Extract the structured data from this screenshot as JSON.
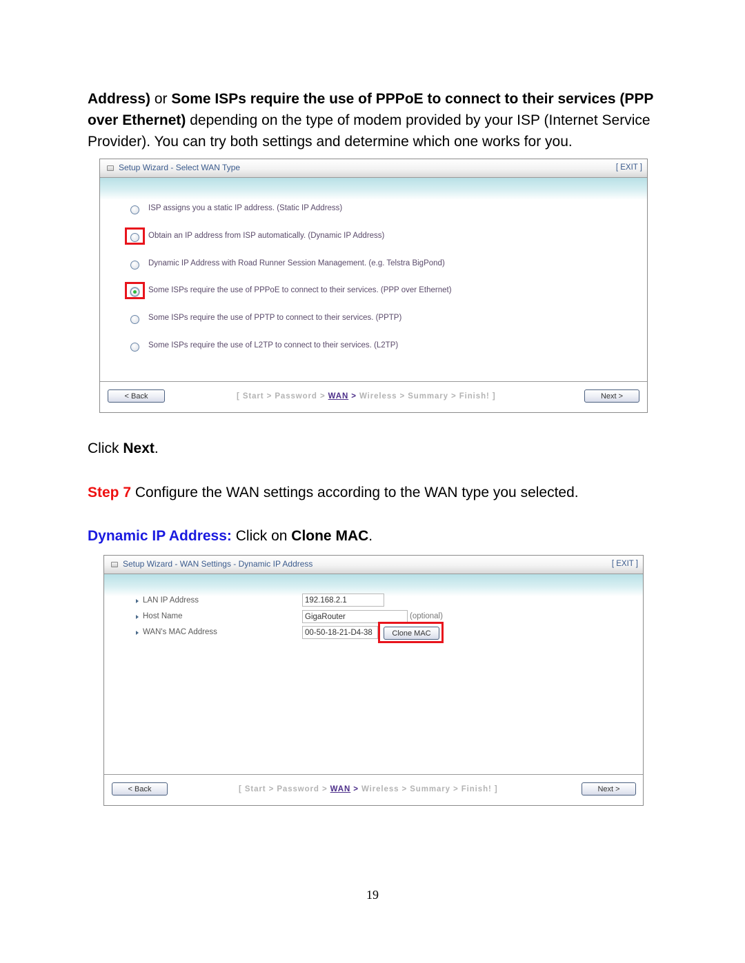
{
  "intro": {
    "line1_bold_a": "Address)",
    "line1_or": " or ",
    "line1_bold_b": "Some ISPs require the use of PPPoE to connect to their services (PPP",
    "line2_bold": "over Ethernet)",
    "line2_rest": " depending on the type of modem provided by your ISP (Internet Service",
    "line3": "Provider). You can try both settings and determine which one works for you."
  },
  "wizard1": {
    "title": "Setup Wizard - Select WAN Type",
    "exit_label": "[ EXIT ]",
    "options": [
      {
        "label": "ISP assigns you a static IP address. (Static IP Address)",
        "checked": false,
        "highlighted": false
      },
      {
        "label": "Obtain an IP address from ISP automatically. (Dynamic IP Address)",
        "checked": false,
        "highlighted": true
      },
      {
        "label": "Dynamic IP Address with Road Runner Session Management. (e.g. Telstra BigPond)",
        "checked": false,
        "highlighted": false
      },
      {
        "label": "Some ISPs require the use of PPPoE to connect to their services. (PPP over Ethernet)",
        "checked": true,
        "highlighted": true
      },
      {
        "label": "Some ISPs require the use of PPTP to connect to their services. (PPTP)",
        "checked": false,
        "highlighted": false
      },
      {
        "label": "Some ISPs require the use of L2TP to connect to their services. (L2TP)",
        "checked": false,
        "highlighted": false
      }
    ],
    "back_label": "< Back",
    "next_label": "Next >"
  },
  "breadcrumb": {
    "open": "[ Start > Password > ",
    "current": "WAN",
    "current_sep": " > ",
    "rest": "Wireless > Summary > Finish! ]"
  },
  "click_next": {
    "prefix": "Click ",
    "bold": "Next",
    "suffix": "."
  },
  "step7": {
    "label": "Step 7",
    "text": " Configure the WAN settings according to the WAN type you selected."
  },
  "dynamic_ip": {
    "label": "Dynamic IP Address:",
    "text_a": " Click on ",
    "bold": "Clone MAC",
    "suffix": "."
  },
  "wizard2": {
    "title": "Setup Wizard - WAN Settings - Dynamic IP Address",
    "exit_label": "[ EXIT ]",
    "fields": [
      {
        "label": "LAN IP Address",
        "value": "192.168.2.1"
      },
      {
        "label": "Host Name",
        "value": "GigaRouter",
        "note": "(optional)"
      },
      {
        "label": "WAN's MAC Address",
        "value": "00-50-18-21-D4-38"
      }
    ],
    "clone_mac_label": "Clone MAC",
    "back_label": "< Back",
    "next_label": "Next >"
  },
  "page_number": "19",
  "colors": {
    "highlight_red": "#e8141c",
    "step_red": "#ee1111",
    "heading_blue": "#1a1adf",
    "wizard_title": "#3a5a8c",
    "breadcrumb_current": "#4d2f8a"
  }
}
